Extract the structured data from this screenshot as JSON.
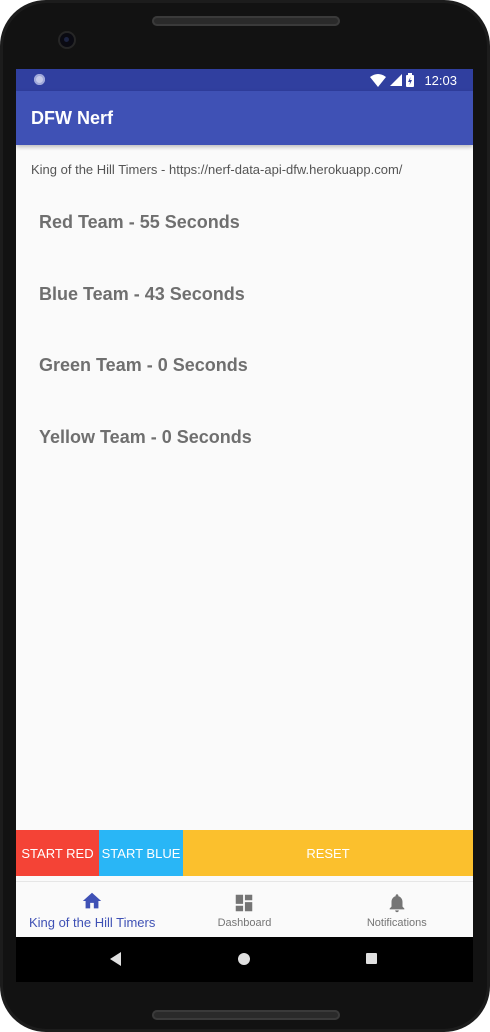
{
  "status_bar": {
    "time": "12:03"
  },
  "app_bar": {
    "title": "DFW Nerf"
  },
  "header": {
    "subtitle": "King of the Hill Timers - https://nerf-data-api-dfw.herokuapp.com/"
  },
  "teams": [
    {
      "label": "Red Team - 55 Seconds"
    },
    {
      "label": "Blue Team - 43 Seconds"
    },
    {
      "label": "Green Team - 0 Seconds"
    },
    {
      "label": "Yellow Team - 0 Seconds"
    }
  ],
  "buttons": {
    "start_red": "START RED",
    "start_blue": "START BLUE",
    "reset": "RESET"
  },
  "bottom_nav": [
    {
      "label": "King of the Hill Timers",
      "icon": "home-icon",
      "active": true
    },
    {
      "label": "Dashboard",
      "icon": "dashboard-icon",
      "active": false
    },
    {
      "label": "Notifications",
      "icon": "bell-icon",
      "active": false
    }
  ],
  "colors": {
    "app_bar": "#3f51b5",
    "status_bar": "#303f9f",
    "start_red": "#f44336",
    "start_blue": "#29b6f6",
    "reset": "#fbc02d",
    "team_text": "#6f6f6f"
  }
}
